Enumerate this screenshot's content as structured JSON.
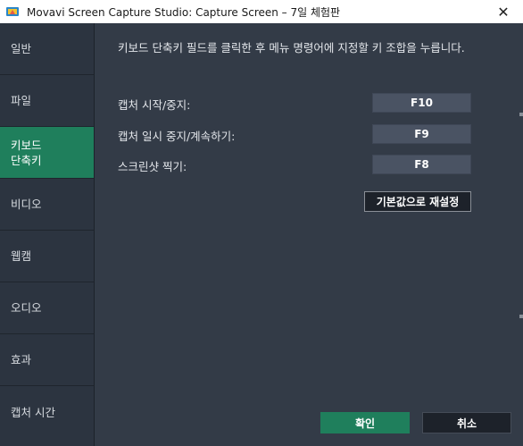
{
  "window": {
    "title": "Movavi Screen Capture Studio: Capture Screen – 7일 체험판",
    "close_glyph": "✕"
  },
  "sidebar": {
    "items": [
      {
        "label": "일반"
      },
      {
        "label": "파일"
      },
      {
        "label": "키보드\n단축키"
      },
      {
        "label": "비디오"
      },
      {
        "label": "웹캠"
      },
      {
        "label": "오디오"
      },
      {
        "label": "효과"
      },
      {
        "label": "캡처 시간"
      }
    ],
    "active_index": 2
  },
  "main": {
    "description": "키보드 단축키 필드를 클릭한 후 메뉴 명령어에 지정할 키 조합을 누릅니다.",
    "shortcuts": [
      {
        "label": "캡처 시작/중지:",
        "key": "F10"
      },
      {
        "label": "캡처 일시 중지/계속하기:",
        "key": "F9"
      },
      {
        "label": "스크린샷 찍기:",
        "key": "F8"
      }
    ],
    "reset_label": "기본값으로 재설정"
  },
  "footer": {
    "ok_label": "확인",
    "cancel_label": "취소"
  },
  "colors": {
    "accent": "#1f7f5c",
    "background": "#333b47",
    "sidebar": "#2c3440",
    "key_field": "#4a5363"
  }
}
